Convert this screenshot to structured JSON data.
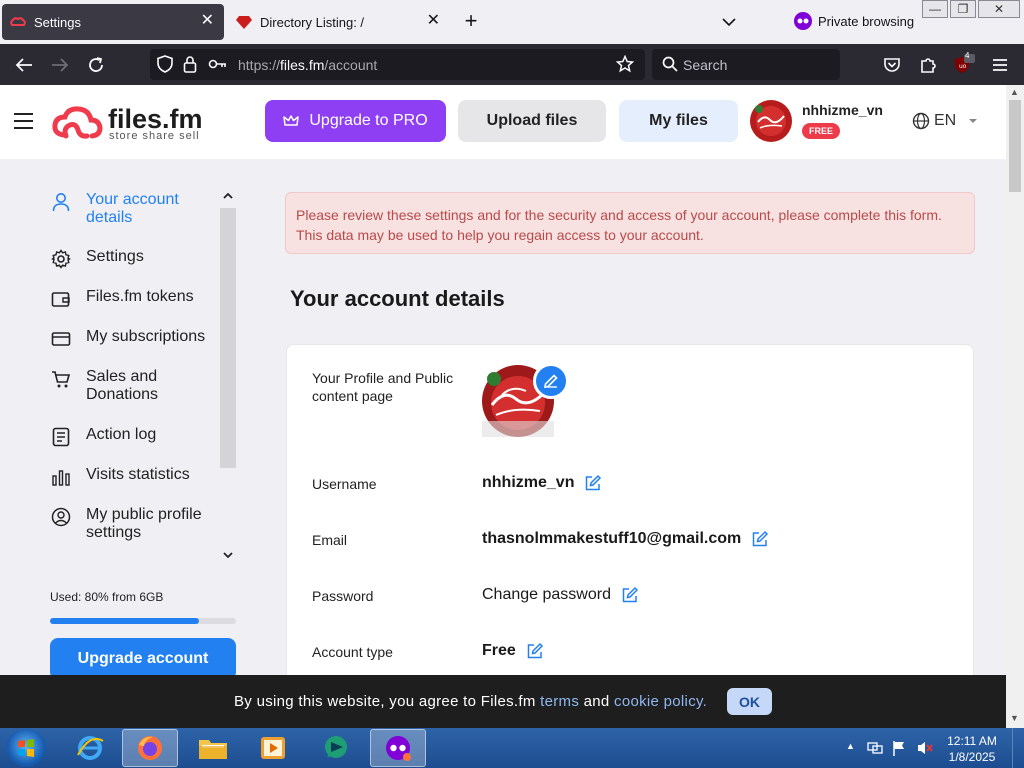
{
  "browser": {
    "tabs": [
      {
        "title": "Settings",
        "active": true
      },
      {
        "title": "Directory Listing: /",
        "active": false
      }
    ],
    "private_label": "Private browsing",
    "url_prefix": "https://",
    "url_host": "files.fm",
    "url_path": "/account",
    "search_placeholder": "Search",
    "extension_badge": "4"
  },
  "header": {
    "logo_name": "files.fm",
    "logo_tagline": "store share sell",
    "upgrade_pro": "Upgrade to PRO",
    "upload_files": "Upload files",
    "my_files": "My files",
    "username": "nhhizme_vn",
    "plan_badge": "FREE",
    "language": "EN"
  },
  "sidebar": {
    "items": [
      {
        "label": "Your account details",
        "icon": "user-icon",
        "active": true
      },
      {
        "label": "Settings",
        "icon": "gear-icon",
        "active": false
      },
      {
        "label": "Files.fm tokens",
        "icon": "wallet-icon",
        "active": false
      },
      {
        "label": "My subscriptions",
        "icon": "card-icon",
        "active": false
      },
      {
        "label": "Sales and Donations",
        "icon": "cart-icon",
        "active": false
      },
      {
        "label": "Action log",
        "icon": "log-icon",
        "active": false
      },
      {
        "label": "Visits statistics",
        "icon": "bar-chart-icon",
        "active": false
      },
      {
        "label": "My public profile settings",
        "icon": "profile-circle-icon",
        "active": false
      }
    ],
    "storage_used_text": "Used: 80% from 6GB",
    "storage_used_fraction": 0.8,
    "upgrade_account": "Upgrade account"
  },
  "main": {
    "alert": "Please review these settings and for the security and access of your account, please complete this form. This data may be used to help you regain access to your account.",
    "title": "Your account details",
    "rows": {
      "profile_label": "Your Profile and Public content page",
      "username_label": "Username",
      "username_value": "nhhizme_vn",
      "email_label": "Email",
      "email_value": "thasnolmmakestuff10@gmail.com",
      "password_label": "Password",
      "password_value": "Change password",
      "account_type_label": "Account type",
      "account_type_value": "Free"
    }
  },
  "cookie": {
    "text_before": "By using this website, you agree to Files.fm ",
    "terms": "terms",
    "and": " and ",
    "cookie_policy": "cookie policy.",
    "ok": "OK"
  },
  "taskbar": {
    "time": "12:11 AM",
    "date": "1/8/2025"
  },
  "colors": {
    "accent": "#2380f1",
    "pro_purple": "#8e3ff3",
    "alert_bg": "#f8e1e1",
    "alert_text": "#b84a4a",
    "badge_red": "#ee3b4a"
  }
}
